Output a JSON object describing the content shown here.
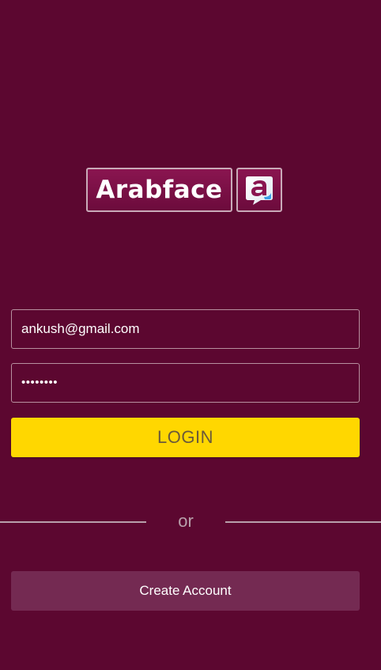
{
  "brand": {
    "logo_text": "Arabface",
    "logo_icon": "arabface-a-icon"
  },
  "login_form": {
    "email_value": "ankush@gmail.com",
    "password_masked": "••••••••",
    "login_label": "LOGIN"
  },
  "divider": {
    "label": "or"
  },
  "signup": {
    "create_account_label": "Create Account"
  },
  "colors": {
    "background": "#5c0730",
    "login_button": "#ffd700",
    "create_button": "#742a52",
    "logo_accent": "#3aa0e8"
  }
}
